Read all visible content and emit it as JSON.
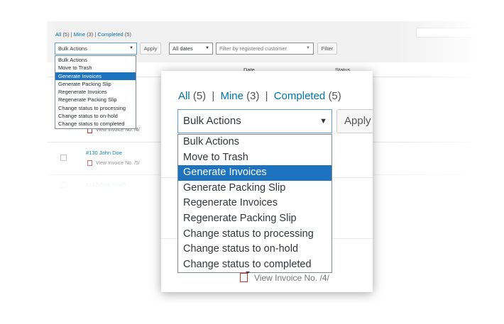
{
  "filters": {
    "views": [
      {
        "label": "All",
        "count": "(5)"
      },
      {
        "label": "Mine",
        "count": "(3)"
      },
      {
        "label": "Completed",
        "count": "(5)"
      }
    ],
    "separator": "|",
    "bulk_selected": "Bulk Actions",
    "apply_label": "Apply",
    "dates_label": "All dates",
    "customer_placeholder": "Filter by registered customer",
    "filter_label": "Filter",
    "dropdown_arrow": "▼"
  },
  "bulk_actions": [
    "Bulk Actions",
    "Move to Trash",
    "Generate Invoices",
    "Generate Packing Slip",
    "Regenerate Invoices",
    "Regenerate Packing Slip",
    "Change status to processing",
    "Change status to on-hold",
    "Change status to completed"
  ],
  "selected_action_index": 2,
  "table": {
    "col_date": "Date",
    "col_status": "Status",
    "rows": [
      {
        "order": "",
        "invoice": "View Invoice No. /4/"
      },
      {
        "order": "#130 John Doe",
        "invoice": "View Invoice No. /5/"
      },
      {
        "order": "#127 Jane Smith",
        "invoice": ""
      }
    ]
  },
  "zoom_invoice": "View Invoice No. /4/",
  "colors": {
    "accent": "#1e73be",
    "link": "#0073aa"
  }
}
